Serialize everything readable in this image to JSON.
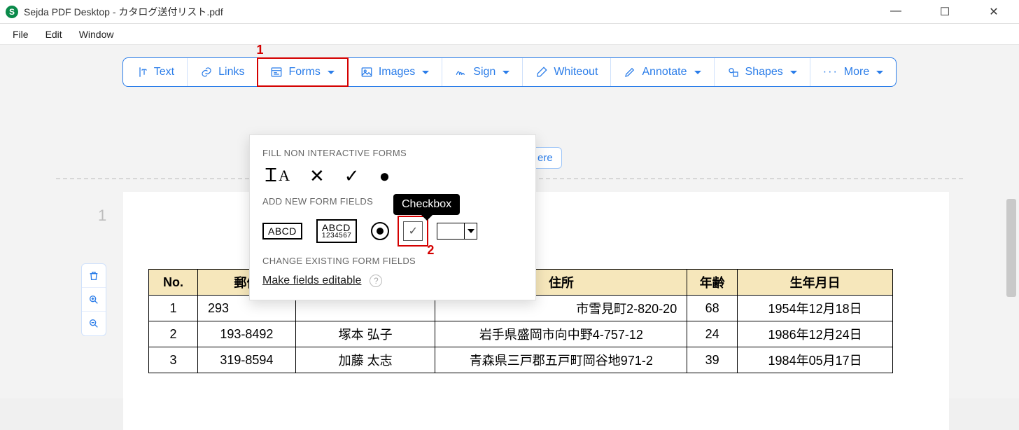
{
  "titlebar": {
    "app_icon_letter": "S",
    "title": "Sejda PDF Desktop - カタログ送付リスト.pdf"
  },
  "menubar": {
    "items": [
      "File",
      "Edit",
      "Window"
    ]
  },
  "toolbar": {
    "text": {
      "label": "Text"
    },
    "links": {
      "label": "Links"
    },
    "forms": {
      "label": "Forms"
    },
    "images": {
      "label": "Images"
    },
    "sign": {
      "label": "Sign"
    },
    "whiteout": {
      "label": "Whiteout"
    },
    "annotate": {
      "label": "Annotate"
    },
    "shapes": {
      "label": "Shapes"
    },
    "more": {
      "label": "More"
    }
  },
  "annotations": {
    "num1": "1",
    "num2": "2",
    "tooltip": "Checkbox"
  },
  "insert_here": {
    "visible_fragment": "ere"
  },
  "forms_panel": {
    "section_fill": "FILL NON INTERACTIVE FORMS",
    "section_add": "ADD NEW FORM FIELDS",
    "section_change": "CHANGE EXISTING FORM FIELDS",
    "make_editable": "Make fields editable",
    "field_text_label": "ABCD",
    "field_textarea_label": "ABCD",
    "field_textarea_sub": "1234567"
  },
  "page_number": "1",
  "table": {
    "headers": {
      "no": "No.",
      "zip": "郵便",
      "name": "",
      "addr": "住所",
      "age": "年齢",
      "dob": "生年月日"
    },
    "rows": [
      {
        "no": "1",
        "zip": "293",
        "name": "",
        "addr": "市雪見町2-820-20",
        "age": "68",
        "dob": "1954年12月18日"
      },
      {
        "no": "2",
        "zip": "193-8492",
        "name": "塚本 弘子",
        "addr": "岩手県盛岡市向中野4-757-12",
        "age": "24",
        "dob": "1986年12月24日"
      },
      {
        "no": "3",
        "zip": "319-8594",
        "name": "加藤 太志",
        "addr": "青森県三戸郡五戸町岡谷地971-2",
        "age": "39",
        "dob": "1984年05月17日"
      }
    ]
  }
}
